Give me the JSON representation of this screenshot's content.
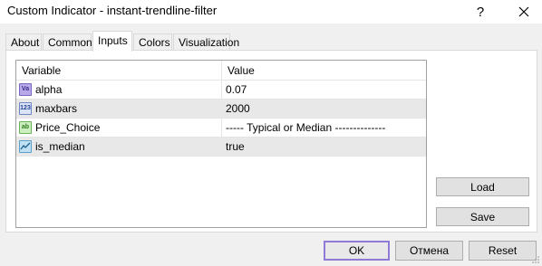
{
  "window": {
    "title": "Custom Indicator - instant-trendline-filter",
    "help_label": "?",
    "close_icon": "close-icon"
  },
  "tabs": [
    {
      "label": "About",
      "active": false
    },
    {
      "label": "Common",
      "active": false
    },
    {
      "label": "Inputs",
      "active": true
    },
    {
      "label": "Colors",
      "active": false
    },
    {
      "label": "Visualization",
      "active": false
    }
  ],
  "grid": {
    "columns": [
      "Variable",
      "Value"
    ],
    "rows": [
      {
        "icon": "double-type-icon",
        "icon_text": "Va",
        "name": "alpha",
        "value": "0.07"
      },
      {
        "icon": "integer-type-icon",
        "icon_text": "123",
        "name": "maxbars",
        "value": "2000"
      },
      {
        "icon": "string-type-icon",
        "icon_text": "ab",
        "name": "Price_Choice",
        "value": "-----  Typical or Median  --------------"
      },
      {
        "icon": "bool-type-icon",
        "icon_text": "",
        "name": "is_median",
        "value": "true"
      }
    ]
  },
  "side_buttons": {
    "load": "Load",
    "save": "Save"
  },
  "bottom_buttons": {
    "ok": "OK",
    "cancel": "Отмена",
    "reset": "Reset"
  },
  "colors": {
    "ok_border": "#8f7ad6",
    "alt_row": "#e8e8e8"
  }
}
